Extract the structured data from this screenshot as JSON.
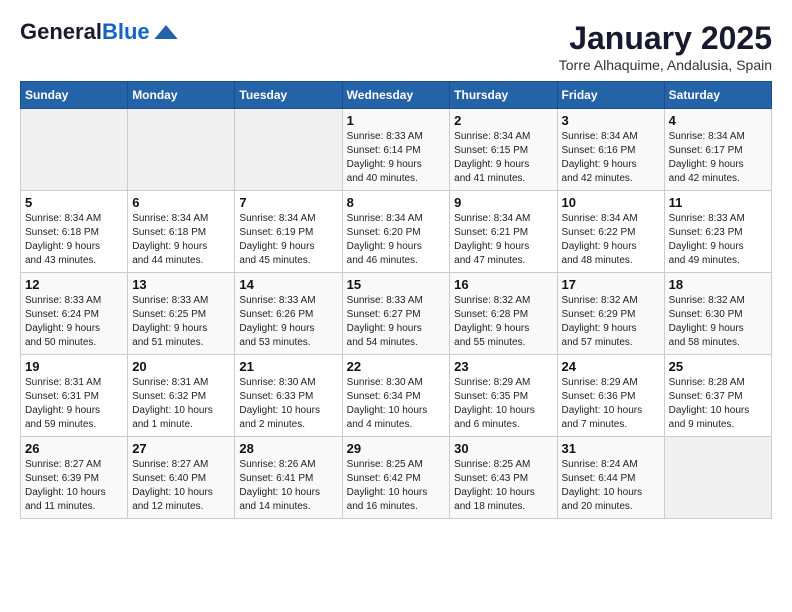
{
  "header": {
    "logo_line1": "General",
    "logo_line2": "Blue",
    "month_title": "January 2025",
    "subtitle": "Torre Alhaquime, Andalusia, Spain"
  },
  "days_of_week": [
    "Sunday",
    "Monday",
    "Tuesday",
    "Wednesday",
    "Thursday",
    "Friday",
    "Saturday"
  ],
  "weeks": [
    [
      {
        "day": "",
        "info": ""
      },
      {
        "day": "",
        "info": ""
      },
      {
        "day": "",
        "info": ""
      },
      {
        "day": "1",
        "info": "Sunrise: 8:33 AM\nSunset: 6:14 PM\nDaylight: 9 hours\nand 40 minutes."
      },
      {
        "day": "2",
        "info": "Sunrise: 8:34 AM\nSunset: 6:15 PM\nDaylight: 9 hours\nand 41 minutes."
      },
      {
        "day": "3",
        "info": "Sunrise: 8:34 AM\nSunset: 6:16 PM\nDaylight: 9 hours\nand 42 minutes."
      },
      {
        "day": "4",
        "info": "Sunrise: 8:34 AM\nSunset: 6:17 PM\nDaylight: 9 hours\nand 42 minutes."
      }
    ],
    [
      {
        "day": "5",
        "info": "Sunrise: 8:34 AM\nSunset: 6:18 PM\nDaylight: 9 hours\nand 43 minutes."
      },
      {
        "day": "6",
        "info": "Sunrise: 8:34 AM\nSunset: 6:18 PM\nDaylight: 9 hours\nand 44 minutes."
      },
      {
        "day": "7",
        "info": "Sunrise: 8:34 AM\nSunset: 6:19 PM\nDaylight: 9 hours\nand 45 minutes."
      },
      {
        "day": "8",
        "info": "Sunrise: 8:34 AM\nSunset: 6:20 PM\nDaylight: 9 hours\nand 46 minutes."
      },
      {
        "day": "9",
        "info": "Sunrise: 8:34 AM\nSunset: 6:21 PM\nDaylight: 9 hours\nand 47 minutes."
      },
      {
        "day": "10",
        "info": "Sunrise: 8:34 AM\nSunset: 6:22 PM\nDaylight: 9 hours\nand 48 minutes."
      },
      {
        "day": "11",
        "info": "Sunrise: 8:33 AM\nSunset: 6:23 PM\nDaylight: 9 hours\nand 49 minutes."
      }
    ],
    [
      {
        "day": "12",
        "info": "Sunrise: 8:33 AM\nSunset: 6:24 PM\nDaylight: 9 hours\nand 50 minutes."
      },
      {
        "day": "13",
        "info": "Sunrise: 8:33 AM\nSunset: 6:25 PM\nDaylight: 9 hours\nand 51 minutes."
      },
      {
        "day": "14",
        "info": "Sunrise: 8:33 AM\nSunset: 6:26 PM\nDaylight: 9 hours\nand 53 minutes."
      },
      {
        "day": "15",
        "info": "Sunrise: 8:33 AM\nSunset: 6:27 PM\nDaylight: 9 hours\nand 54 minutes."
      },
      {
        "day": "16",
        "info": "Sunrise: 8:32 AM\nSunset: 6:28 PM\nDaylight: 9 hours\nand 55 minutes."
      },
      {
        "day": "17",
        "info": "Sunrise: 8:32 AM\nSunset: 6:29 PM\nDaylight: 9 hours\nand 57 minutes."
      },
      {
        "day": "18",
        "info": "Sunrise: 8:32 AM\nSunset: 6:30 PM\nDaylight: 9 hours\nand 58 minutes."
      }
    ],
    [
      {
        "day": "19",
        "info": "Sunrise: 8:31 AM\nSunset: 6:31 PM\nDaylight: 9 hours\nand 59 minutes."
      },
      {
        "day": "20",
        "info": "Sunrise: 8:31 AM\nSunset: 6:32 PM\nDaylight: 10 hours\nand 1 minute."
      },
      {
        "day": "21",
        "info": "Sunrise: 8:30 AM\nSunset: 6:33 PM\nDaylight: 10 hours\nand 2 minutes."
      },
      {
        "day": "22",
        "info": "Sunrise: 8:30 AM\nSunset: 6:34 PM\nDaylight: 10 hours\nand 4 minutes."
      },
      {
        "day": "23",
        "info": "Sunrise: 8:29 AM\nSunset: 6:35 PM\nDaylight: 10 hours\nand 6 minutes."
      },
      {
        "day": "24",
        "info": "Sunrise: 8:29 AM\nSunset: 6:36 PM\nDaylight: 10 hours\nand 7 minutes."
      },
      {
        "day": "25",
        "info": "Sunrise: 8:28 AM\nSunset: 6:37 PM\nDaylight: 10 hours\nand 9 minutes."
      }
    ],
    [
      {
        "day": "26",
        "info": "Sunrise: 8:27 AM\nSunset: 6:39 PM\nDaylight: 10 hours\nand 11 minutes."
      },
      {
        "day": "27",
        "info": "Sunrise: 8:27 AM\nSunset: 6:40 PM\nDaylight: 10 hours\nand 12 minutes."
      },
      {
        "day": "28",
        "info": "Sunrise: 8:26 AM\nSunset: 6:41 PM\nDaylight: 10 hours\nand 14 minutes."
      },
      {
        "day": "29",
        "info": "Sunrise: 8:25 AM\nSunset: 6:42 PM\nDaylight: 10 hours\nand 16 minutes."
      },
      {
        "day": "30",
        "info": "Sunrise: 8:25 AM\nSunset: 6:43 PM\nDaylight: 10 hours\nand 18 minutes."
      },
      {
        "day": "31",
        "info": "Sunrise: 8:24 AM\nSunset: 6:44 PM\nDaylight: 10 hours\nand 20 minutes."
      },
      {
        "day": "",
        "info": ""
      }
    ]
  ]
}
